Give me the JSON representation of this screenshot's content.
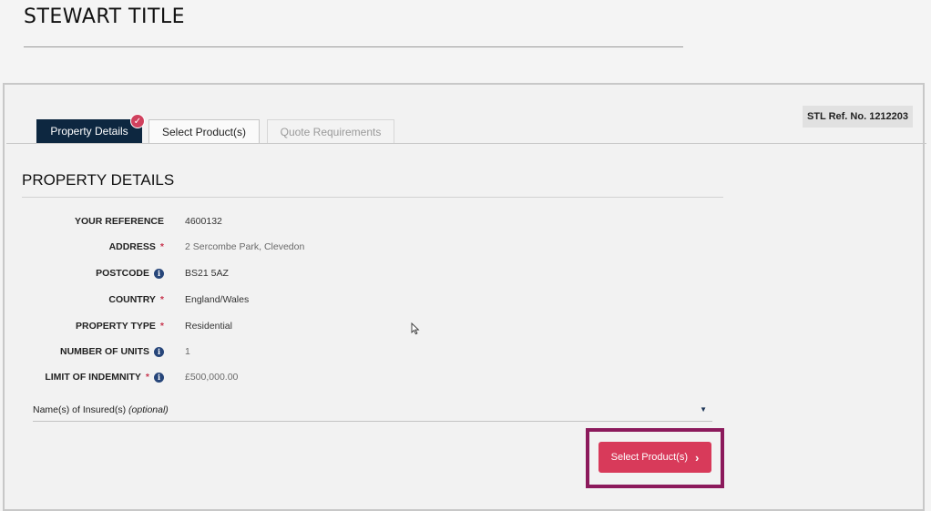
{
  "brand": {
    "title": "STEWART TITLE"
  },
  "tabs": [
    {
      "label": "Property Details",
      "state": "active",
      "completed": true
    },
    {
      "label": "Select Product(s)",
      "state": "enabled"
    },
    {
      "label": "Quote Requirements",
      "state": "disabled"
    }
  ],
  "ref_badge": "STL Ref. No. 1212203",
  "section": {
    "title": "PROPERTY DETAILS"
  },
  "fields": {
    "reference": {
      "label": "YOUR REFERENCE",
      "value": "4600132"
    },
    "address": {
      "label": "ADDRESS",
      "value": "2 Sercombe Park, Clevedon",
      "required": "*"
    },
    "postcode": {
      "label": "POSTCODE",
      "value": "BS21 5AZ"
    },
    "country": {
      "label": "COUNTRY",
      "value": "England/Wales",
      "required": "*"
    },
    "property_type": {
      "label": "PROPERTY TYPE",
      "value": "Residential",
      "required": "*"
    },
    "units": {
      "label": "NUMBER OF UNITS",
      "value": "1"
    },
    "indemnity": {
      "label": "LIMIT OF INDEMNITY",
      "value": "£500,000.00",
      "required": "*"
    }
  },
  "insured": {
    "label": "Name(s) of Insured(s)",
    "optional": "(optional)"
  },
  "actions": {
    "next_label": "Select Product(s)"
  },
  "icons": {
    "check": "check-badge-icon",
    "info": "info-icon",
    "caret": "caret-down-icon",
    "chevron": "chevron-right-icon",
    "cursor": "mouse-pointer-icon"
  },
  "colors": {
    "tab_active": "#0d2740",
    "primary_button": "#d83a5a",
    "required_star": "#c8364f",
    "info_icon": "#27467a",
    "highlight": "#8c1a5c"
  }
}
